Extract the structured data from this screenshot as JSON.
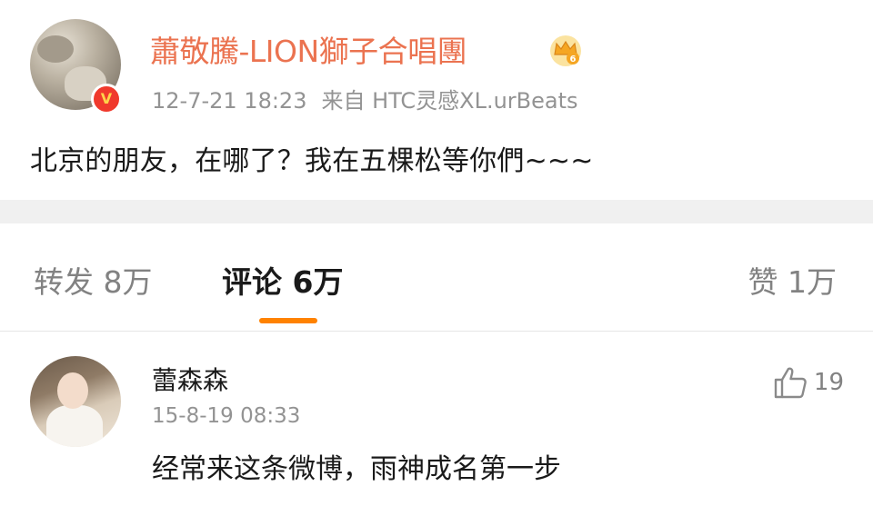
{
  "post": {
    "author_name": "蕭敬騰-LION獅子合唱團",
    "verified_badge_glyph": "V",
    "crown_badge_glyph": "6",
    "timestamp": "12-7-21 18:23",
    "source": "来自 HTC灵感XL.urBeats",
    "content": "北京的朋友，在哪了？我在五棵松等你們~~~",
    "colors": {
      "author_name": "#eb7350",
      "verified_badge": "#f0392c",
      "crown_badge": "#f5a623"
    }
  },
  "tabs": {
    "repost_label": "转发 8万",
    "comments_label": "评论 6万",
    "likes_label": "赞 1万",
    "active": "comments",
    "indicator_color": "#ff8200"
  },
  "comment": {
    "author_name": "蕾森森",
    "timestamp": "15-8-19 08:33",
    "text": "经常来这条微博，雨神成名第一步",
    "like_icon": "thumbs-up-icon",
    "like_count": "19"
  }
}
